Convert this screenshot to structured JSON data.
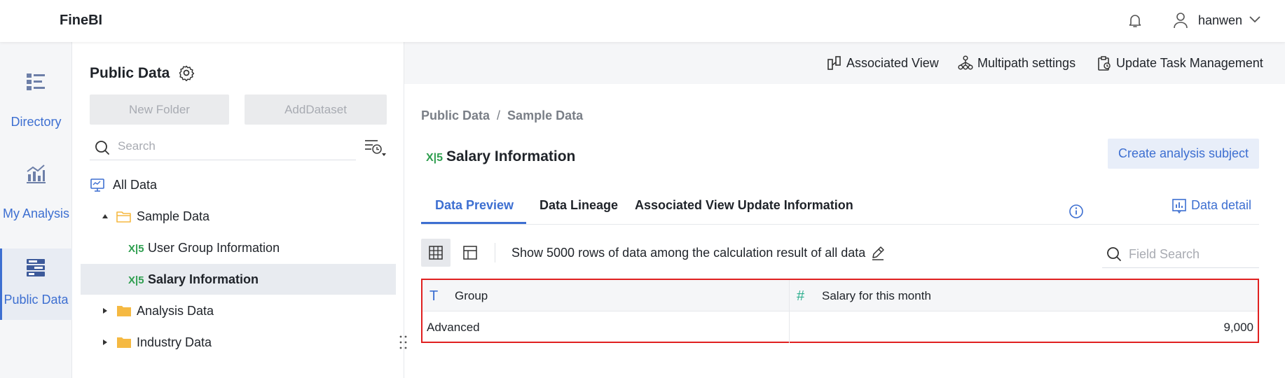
{
  "app": {
    "logo": "FineBI",
    "username": "hanwen"
  },
  "nav": {
    "items": [
      {
        "label": "Directory",
        "icon": "directory-icon"
      },
      {
        "label": "My Analysis",
        "icon": "analysis-chart-icon"
      },
      {
        "label": "Public Data",
        "icon": "database-icon",
        "active": true
      }
    ]
  },
  "sidebar": {
    "title": "Public Data",
    "new_folder": "New Folder",
    "add_dataset": "AddDataset",
    "search_placeholder": "Search",
    "tree": [
      {
        "label": "All Data",
        "level": 0,
        "type": "root"
      },
      {
        "label": "Sample Data",
        "level": 1,
        "type": "folder",
        "expanded": true
      },
      {
        "label": "User Group Information",
        "level": 2,
        "type": "excel"
      },
      {
        "label": "Salary Information",
        "level": 2,
        "type": "excel",
        "selected": true
      },
      {
        "label": "Analysis Data",
        "level": 1,
        "type": "folder",
        "expanded": false
      },
      {
        "label": "Industry Data",
        "level": 1,
        "type": "folder",
        "expanded": false
      }
    ]
  },
  "toolbar": {
    "associated_view": "Associated View",
    "multipath": "Multipath settings",
    "update_task": "Update Task Management"
  },
  "main": {
    "breadcrumb": [
      "Public Data",
      "Sample Data"
    ],
    "breadcrumb_sep": "/",
    "title": "Salary Information",
    "create_btn": "Create analysis subject",
    "tabs": [
      "Data Preview",
      "Data Lineage",
      "Associated View Update Information"
    ],
    "active_tab": 0,
    "data_detail": "Data detail",
    "rows_info": "Show 5000 rows of data among the calculation result of all data",
    "field_search_placeholder": "Field Search"
  },
  "table": {
    "columns": [
      {
        "name": "Group",
        "type_icon": "T"
      },
      {
        "name": "Salary for this month",
        "type_icon": "#"
      }
    ],
    "rows": [
      [
        "Advanced",
        "9,000"
      ]
    ]
  },
  "colors": {
    "accent": "#3d6fd1",
    "highlight_border": "#e02020",
    "excel_green": "#2e9e4f",
    "folder": "#f5b942"
  }
}
